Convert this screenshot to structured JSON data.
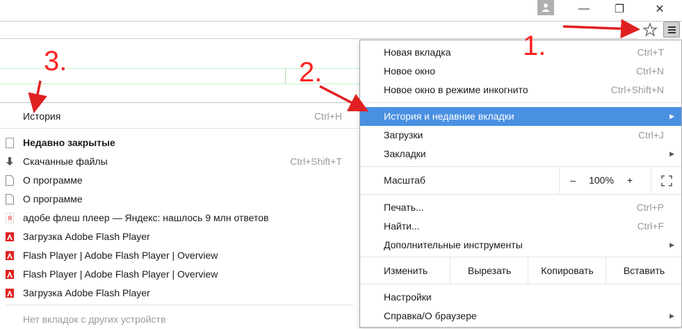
{
  "window": {
    "minimize": "—",
    "restore": "❐",
    "close": "✕"
  },
  "toolbar": {
    "star_icon": "star-icon",
    "menu_icon": "hamburger-menu-icon"
  },
  "callouts": [
    "1.",
    "2.",
    "3."
  ],
  "main_menu": {
    "items": [
      {
        "label": "Новая вкладка",
        "shortcut": "Ctrl+T"
      },
      {
        "label": "Новое окно",
        "shortcut": "Ctrl+N"
      },
      {
        "label": "Новое окно в режиме инкогнито",
        "shortcut": "Ctrl+Shift+N"
      },
      {
        "label": "История и недавние вкладки",
        "shortcut": "",
        "submenu": true
      },
      {
        "label": "Загрузки",
        "shortcut": "Ctrl+J"
      },
      {
        "label": "Закладки",
        "shortcut": "",
        "submenu": true
      }
    ],
    "zoom": {
      "label": "Масштаб",
      "minus": "–",
      "value": "100%",
      "plus": "+",
      "fullscreen": "⛶"
    },
    "items2": [
      {
        "label": "Печать...",
        "shortcut": "Ctrl+P"
      },
      {
        "label": "Найти...",
        "shortcut": "Ctrl+F"
      },
      {
        "label": "Дополнительные инструменты",
        "shortcut": "",
        "submenu": true
      }
    ],
    "edit": {
      "label": "Изменить",
      "cut": "Вырезать",
      "copy": "Копировать",
      "paste": "Вставить"
    },
    "items3": [
      {
        "label": "Настройки",
        "shortcut": ""
      },
      {
        "label": "Справка/О браузере",
        "shortcut": "",
        "submenu": true
      }
    ]
  },
  "history_menu": {
    "history": {
      "label": "История",
      "shortcut": "Ctrl+H"
    },
    "recent_header": "Недавно закрытые",
    "items": [
      {
        "label": "Скачанные файлы",
        "shortcut": "Ctrl+Shift+T",
        "icon": "download-icon"
      },
      {
        "label": "О программе",
        "shortcut": "",
        "icon": "page-icon"
      },
      {
        "label": "О программе",
        "shortcut": "",
        "icon": "page-icon"
      },
      {
        "label": "адобе флеш плеер — Яндекс: нашлось 9 млн ответов",
        "shortcut": "",
        "icon": "yandex-icon"
      },
      {
        "label": "Загрузка Adobe Flash Player",
        "shortcut": "",
        "icon": "adobe-icon"
      },
      {
        "label": "Flash Player | Adobe Flash Player | Overview",
        "shortcut": "",
        "icon": "adobe-icon"
      },
      {
        "label": "Flash Player | Adobe Flash Player | Overview",
        "shortcut": "",
        "icon": "adobe-icon"
      },
      {
        "label": "Загрузка Adobe Flash Player",
        "shortcut": "",
        "icon": "adobe-icon"
      }
    ],
    "no_tabs": "Нет вкладок с других устройств"
  },
  "colors": {
    "accent": "#4a90e2",
    "callout": "#ff2020"
  }
}
